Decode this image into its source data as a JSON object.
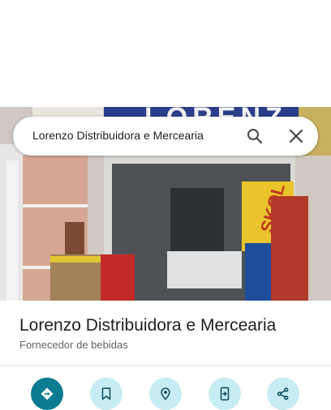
{
  "search": {
    "query": "Lorenzo Distribuidora e Mercearia"
  },
  "place": {
    "title": "Lorenzo Distribuidora e Mercearia",
    "category": "Fornecedor de bebidas"
  },
  "photo": {
    "sign_text": "LORENZ",
    "skol_text": "SKOL"
  },
  "icons": {
    "search": "search-icon",
    "close": "close-icon",
    "directions": "directions-icon",
    "save": "bookmark-icon",
    "nearby": "nearby-icon",
    "send_to_phone": "send-to-phone-icon",
    "share": "share-icon"
  },
  "colors": {
    "primary_action": "#0b7b91",
    "secondary_action": "#c7ecf3",
    "icon_dark": "#0b4a5a"
  }
}
